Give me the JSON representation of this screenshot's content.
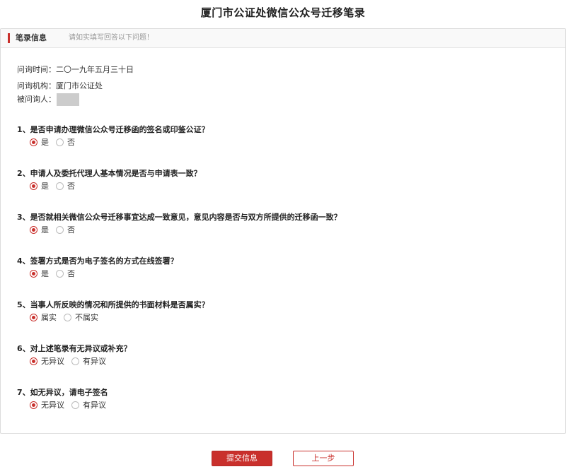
{
  "page": {
    "title": "厦门市公证处微信公众号迁移笔录"
  },
  "panel": {
    "header": "笔录信息",
    "hint": "请如实填写回答以下问题！"
  },
  "meta": {
    "time_label": "问询时间：",
    "time_value": "二〇一九年五月三十日",
    "org_label": "问询机构：",
    "org_value": "厦门市公证处",
    "person_label": "被问询人："
  },
  "questions": [
    {
      "text": "1、是否申请办理微信公众号迁移函的签名或印鉴公证？",
      "options": [
        "是",
        "否"
      ],
      "selected": 0
    },
    {
      "text": "2、申请人及委托代理人基本情况是否与申请表一致？",
      "options": [
        "是",
        "否"
      ],
      "selected": 0
    },
    {
      "text": "3、是否就相关微信公众号迁移事宜达成一致意见，意见内容是否与双方所提供的迁移函一致？",
      "options": [
        "是",
        "否"
      ],
      "selected": 0
    },
    {
      "text": "4、签署方式是否为电子签名的方式在线签署？",
      "options": [
        "是",
        "否"
      ],
      "selected": 0
    },
    {
      "text": "5、当事人所反映的情况和所提供的书面材料是否属实？",
      "options": [
        "属实",
        "不属实"
      ],
      "selected": 0
    },
    {
      "text": "6、对上述笔录有无异议或补充？",
      "options": [
        "无异议",
        "有异议"
      ],
      "selected": 0
    },
    {
      "text": "7、如无异议，请电子签名",
      "options": [
        "无异议",
        "有异议"
      ],
      "selected": 0
    }
  ],
  "buttons": {
    "submit": "提交信息",
    "prev": "上一步"
  },
  "colors": {
    "accent": "#c9302c"
  }
}
